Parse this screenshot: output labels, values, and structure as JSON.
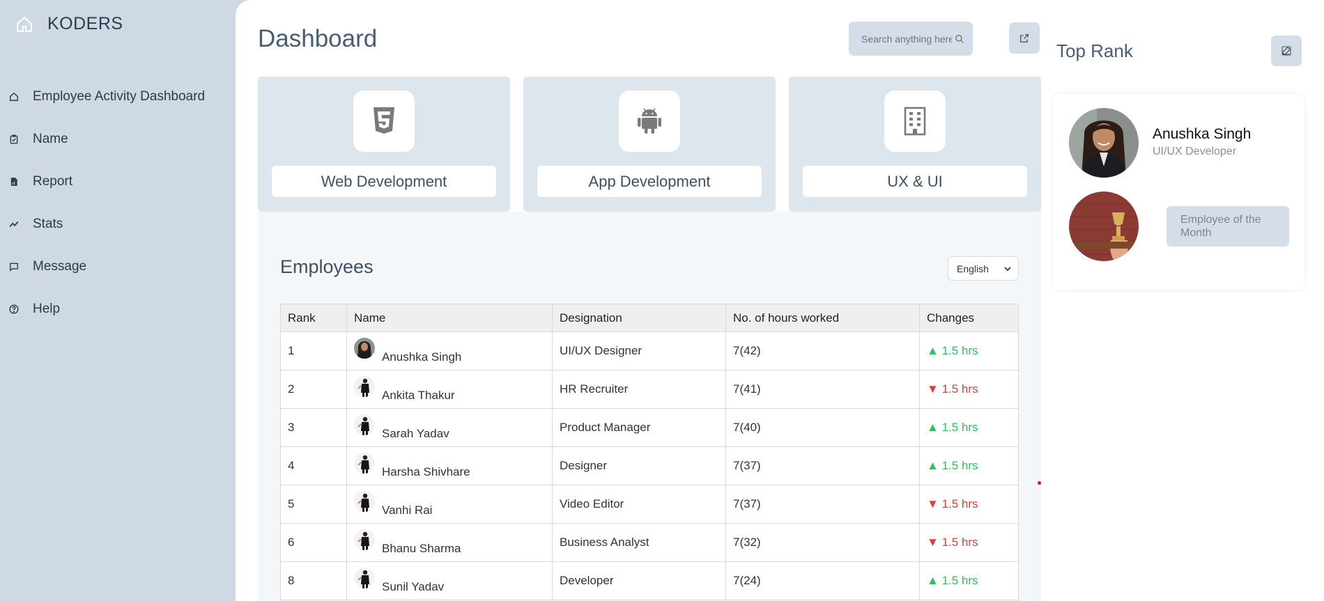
{
  "sidebar": {
    "brand": "KODERS",
    "items": [
      {
        "label": "Employee Activity Dashboard",
        "icon": "home-icon"
      },
      {
        "label": "Name",
        "icon": "clipboard-check-icon"
      },
      {
        "label": "Report",
        "icon": "file-chart-icon"
      },
      {
        "label": "Stats",
        "icon": "chart-line-icon"
      },
      {
        "label": "Message",
        "icon": "chat-icon"
      },
      {
        "label": "Help",
        "icon": "help-circle-icon"
      }
    ]
  },
  "header": {
    "title": "Dashboard",
    "search_placeholder": "Search anything here..."
  },
  "categories": [
    {
      "label": "Web Development",
      "icon": "html5-icon"
    },
    {
      "label": "App Development",
      "icon": "android-icon"
    },
    {
      "label": "UX & UI",
      "icon": "building-icon"
    }
  ],
  "employees": {
    "title": "Employees",
    "language": "English",
    "columns": [
      "Rank",
      "Name",
      "Designation",
      "No. of hours worked",
      "Changes"
    ],
    "rows": [
      {
        "rank": "1",
        "name": "Anushka Singh",
        "designation": "UI/UX Designer",
        "hours": "7(42)",
        "change": "1.5 hrs",
        "direction": "up"
      },
      {
        "rank": "2",
        "name": "Ankita Thakur",
        "designation": "HR Recruiter",
        "hours": "7(41)",
        "change": "1.5 hrs",
        "direction": "down"
      },
      {
        "rank": "3",
        "name": "Sarah Yadav",
        "designation": "Product Manager",
        "hours": "7(40)",
        "change": "1.5 hrs",
        "direction": "up"
      },
      {
        "rank": "4",
        "name": "Harsha Shivhare",
        "designation": "Designer",
        "hours": "7(37)",
        "change": "1.5 hrs",
        "direction": "up"
      },
      {
        "rank": "5",
        "name": "Vanhi Rai",
        "designation": "Video Editor",
        "hours": "7(37)",
        "change": "1.5 hrs",
        "direction": "down"
      },
      {
        "rank": "6",
        "name": "Bhanu Sharma",
        "designation": "Business Analyst",
        "hours": "7(32)",
        "change": "1.5 hrs",
        "direction": "down"
      },
      {
        "rank": "8",
        "name": "Sunil Yadav",
        "designation": "Developer",
        "hours": "7(24)",
        "change": "1.5 hrs",
        "direction": "up"
      }
    ]
  },
  "top_rank": {
    "title": "Top Rank",
    "name": "Anushka Singh",
    "role": "UI/UX Developer",
    "badge_text": "EMPLOYEE OF THE MONTH",
    "button_label": "Employee of the Month"
  },
  "colors": {
    "sidebar_bg": "#cfd9e3",
    "card_bg": "#dde5ed",
    "up": "#2fbf5b",
    "down": "#e33c3c"
  }
}
